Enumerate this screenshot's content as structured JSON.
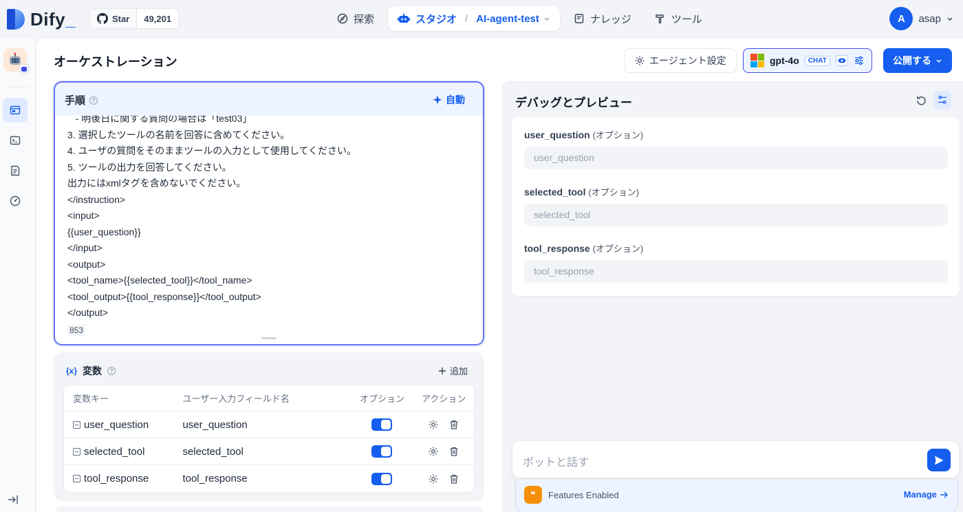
{
  "header": {
    "logo_text": "Dify",
    "logo_underscore": "_",
    "github": {
      "star_label": "Star",
      "star_count": "49,201"
    },
    "nav": {
      "explore": "探索",
      "studio": "スタジオ",
      "separator": "/",
      "app_name": "AI-agent-test",
      "knowledge": "ナレッジ",
      "tools": "ツール"
    },
    "user": {
      "initial": "A",
      "name": "asap"
    }
  },
  "page": {
    "title": "オーケストレーション",
    "agent_settings_label": "エージェント設定",
    "model": {
      "name": "gpt-4o",
      "tag": "CHAT"
    },
    "publish_label": "公開する"
  },
  "instruction": {
    "title": "手順",
    "help": "?",
    "auto_label": "自動",
    "lines": [
      "   - 明後日に関する質問の場合は「test03」",
      "3. 選択したツールの名前を回答に含めてください。",
      "4. ユーザの質問をそのままツールの入力として使用してください。",
      "5. ツールの出力を回答してください。",
      "出力にはxmlタグを含めないでください。",
      "</instruction>",
      "<input>",
      "{{user_question}}",
      "</input>",
      "<output>",
      "<tool_name>{{selected_tool}}</tool_name>",
      "<tool_output>{{tool_response}}</tool_output>",
      "</output>"
    ],
    "char_count": "853"
  },
  "variables": {
    "title": "変数",
    "brace": "{x}",
    "help": "?",
    "add_label": "追加",
    "columns": {
      "key": "変数キー",
      "field_name": "ユーザー入力フィールド名",
      "optional": "オプション",
      "action": "アクション"
    },
    "rows": [
      {
        "key": "user_question",
        "field_name": "user_question",
        "optional": true
      },
      {
        "key": "selected_tool",
        "field_name": "selected_tool",
        "optional": true
      },
      {
        "key": "tool_response",
        "field_name": "tool_response",
        "optional": true
      }
    ]
  },
  "debug": {
    "title": "デバッグとプレビュー",
    "fields": [
      {
        "label": "user_question",
        "opt": "(オプション)",
        "placeholder": "user_question"
      },
      {
        "label": "selected_tool",
        "opt": "(オプション)",
        "placeholder": "selected_tool"
      },
      {
        "label": "tool_response",
        "opt": "(オプション)",
        "placeholder": "tool_response"
      }
    ],
    "chat_placeholder": "ボットと話す",
    "features_enabled": "Features Enabled",
    "manage_label": "Manage"
  },
  "colors": {
    "accent": "#155eef",
    "indigo": "#444ce7",
    "features_icon": "#f79009"
  },
  "icons": {
    "explore": "compass-icon",
    "studio": "robot-icon",
    "knowledge": "book-icon",
    "tools": "hammer-icon",
    "agent_settings": "gear-icon",
    "model_settings": "sliders-icon",
    "send": "send-icon"
  }
}
